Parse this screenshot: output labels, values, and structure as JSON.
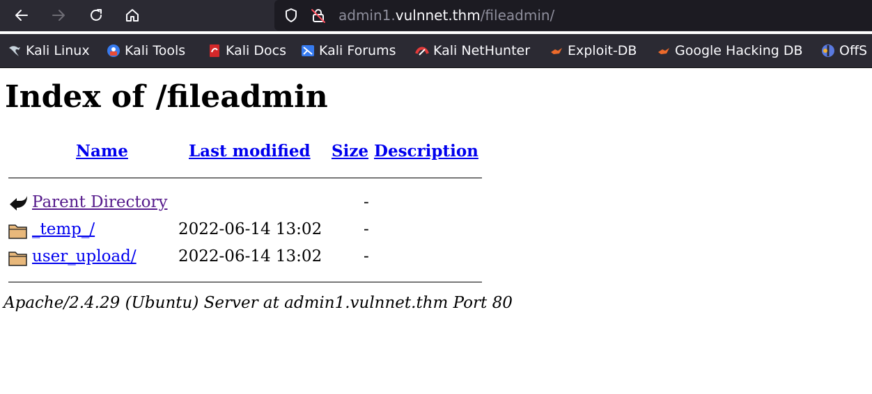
{
  "browser": {
    "url": {
      "prefix": "admin1.",
      "host": "vulnnet.thm",
      "path": "/fileadmin/"
    },
    "bookmarks": [
      {
        "label": "Kali Linux",
        "icon": "kali-dragon-icon"
      },
      {
        "label": "Kali Tools",
        "icon": "kali-tools-icon"
      },
      {
        "label": "Kali Docs",
        "icon": "kali-docs-icon"
      },
      {
        "label": "Kali Forums",
        "icon": "kali-forums-icon"
      },
      {
        "label": "Kali NetHunter",
        "icon": "kali-nethunter-icon"
      },
      {
        "label": "Exploit-DB",
        "icon": "exploit-db-icon"
      },
      {
        "label": "Google Hacking DB",
        "icon": "google-hacking-db-icon"
      },
      {
        "label": "OffS",
        "icon": "offsec-icon"
      }
    ]
  },
  "page": {
    "title": "Index of /fileadmin",
    "columns": {
      "name": "Name",
      "last_modified": "Last modified",
      "size": "Size",
      "description": "Description"
    },
    "rows": [
      {
        "name": "Parent Directory",
        "modified": "",
        "size": "-",
        "icon": "back-arrow-icon"
      },
      {
        "name": "_temp_/",
        "modified": "2022-06-14 13:02",
        "size": "-",
        "icon": "folder-icon"
      },
      {
        "name": "user_upload/",
        "modified": "2022-06-14 13:02",
        "size": "-",
        "icon": "folder-icon"
      }
    ],
    "footer": "Apache/2.4.29 (Ubuntu) Server at admin1.vulnnet.thm Port 80"
  },
  "colors": {
    "link": "#0000ee",
    "visited_link": "#551a8b",
    "chrome_bg": "#2b2a33",
    "urlbar_bg": "#1c1b22"
  }
}
